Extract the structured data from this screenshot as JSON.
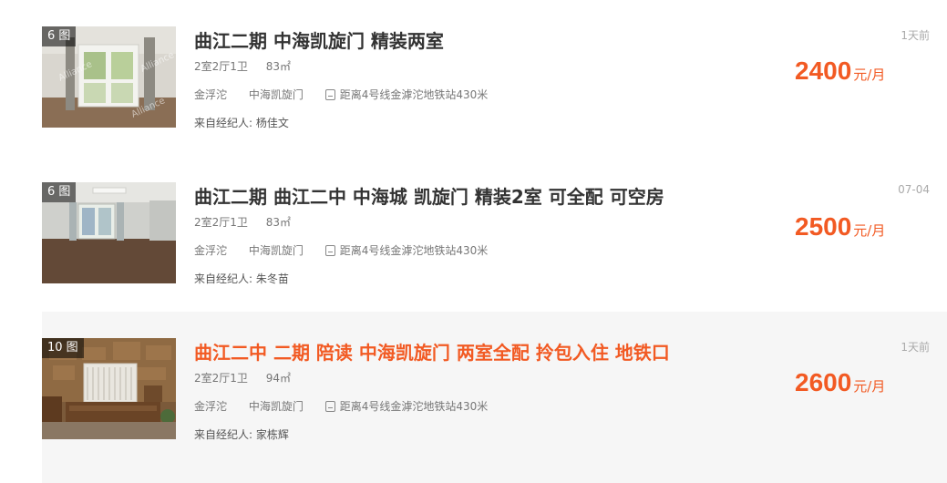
{
  "listings": [
    {
      "photo_count": "6 图",
      "title": "曲江二期 中海凯旋门 精装两室",
      "layout": "2室2厅1卫",
      "area": "83㎡",
      "district": "金浮沱",
      "community": "中海凯旋门",
      "subway": "距离4号线金滹沱地铁站430米",
      "agent": "来自经纪人: 杨佳文",
      "time": "1天前",
      "price": "2400",
      "price_unit": "元/月",
      "photo_watermark": "Alliance"
    },
    {
      "photo_count": "6 图",
      "title": "曲江二期 曲江二中 中海城 凯旋门 精装2室 可全配 可空房",
      "layout": "2室2厅1卫",
      "area": "83㎡",
      "district": "金浮沱",
      "community": "中海凯旋门",
      "subway": "距离4号线金滹沱地铁站430米",
      "agent": "来自经纪人: 朱冬苗",
      "time": "07-04",
      "price": "2500",
      "price_unit": "元/月"
    },
    {
      "photo_count": "10 图",
      "title": "曲江二中 二期 陪读 中海凯旋门 两室全配 拎包入住 地铁口",
      "layout": "2室2厅1卫",
      "area": "94㎡",
      "district": "金浮沱",
      "community": "中海凯旋门",
      "subway": "距离4号线金滹沱地铁站430米",
      "agent": "来自经纪人: 家栋辉",
      "time": "1天前",
      "price": "2600",
      "price_unit": "元/月",
      "highlighted": true
    }
  ],
  "colors": {
    "accent": "#f25a23",
    "muted": "#aaaaaa",
    "highlight_bg": "#f6f6f6"
  },
  "icons": {
    "subway": "subway-icon"
  }
}
